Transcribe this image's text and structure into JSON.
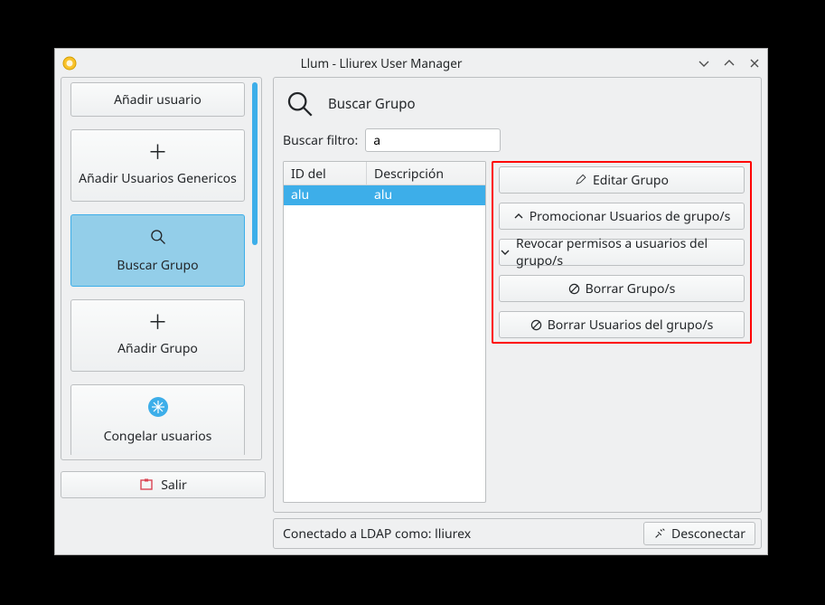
{
  "window": {
    "title": "Llum - Lliurex User Manager"
  },
  "sidebar": {
    "items": [
      {
        "label": "Añadir usuario",
        "icon": "none-trunc"
      },
      {
        "label": "Añadir Usuarios Genericos",
        "icon": "plus"
      },
      {
        "label": "Buscar Grupo",
        "icon": "search",
        "selected": true
      },
      {
        "label": "Añadir Grupo",
        "icon": "plus"
      },
      {
        "label": "Congelar usuarios",
        "icon": "freeze"
      }
    ],
    "exit_label": "Salir"
  },
  "detail": {
    "header_label": "Buscar Grupo",
    "filter_label": "Buscar filtro:",
    "filter_value": "a",
    "columns": {
      "c1": "ID del Grupo",
      "c2": "Descripción"
    },
    "rows": [
      {
        "id": "alu",
        "desc": "alu",
        "selected": true
      }
    ],
    "actions": {
      "edit": "Editar Grupo",
      "promote": "Promocionar Usuarios de grupo/s",
      "revoke": "Revocar permisos a usuarios del grupo/s",
      "delete_group": "Borrar Grupo/s",
      "delete_users": "Borrar Usuarios del grupo/s"
    }
  },
  "footer": {
    "status": "Conectado a LDAP como: lliurex",
    "disconnect_label": "Desconectar"
  }
}
